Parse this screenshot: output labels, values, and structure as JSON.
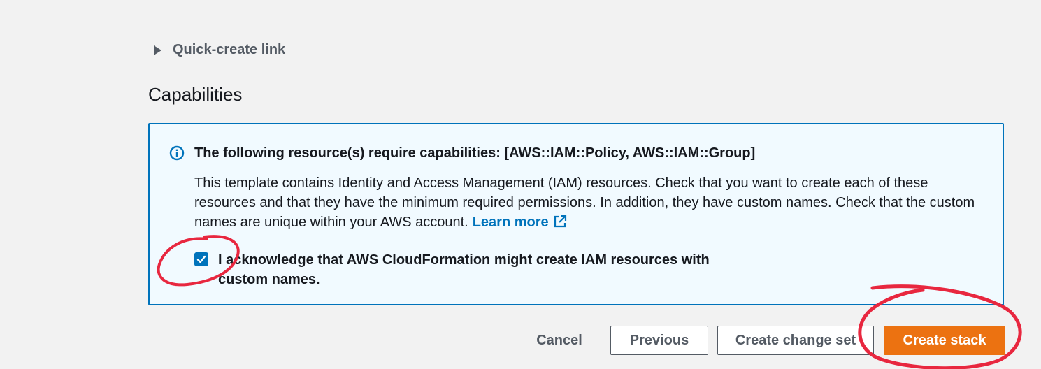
{
  "quick_create": {
    "label": "Quick-create link",
    "icon": "caret-right-icon"
  },
  "capabilities": {
    "title": "Capabilities",
    "alert": {
      "icon": "info-icon",
      "title": "The following resource(s) require capabilities: [AWS::IAM::Policy, AWS::IAM::Group]",
      "body": "This template contains Identity and Access Management (IAM) resources. Check that you want to create each of these resources and that they have the minimum required permissions. In addition, they have custom names. Check that the custom names are unique within your AWS account.",
      "learn_more": "Learn more",
      "learn_more_icon": "external-link-icon"
    },
    "acknowledge": {
      "checked": true,
      "label": "I acknowledge that AWS CloudFormation might create IAM resources with custom names."
    }
  },
  "actions": {
    "cancel": "Cancel",
    "previous": "Previous",
    "create_change_set": "Create change set",
    "create_stack": "Create stack"
  },
  "colors": {
    "accent": "#0073bb",
    "primary_button": "#ec7211",
    "alert_background": "#f1faff",
    "annotation": "#e8273f"
  }
}
